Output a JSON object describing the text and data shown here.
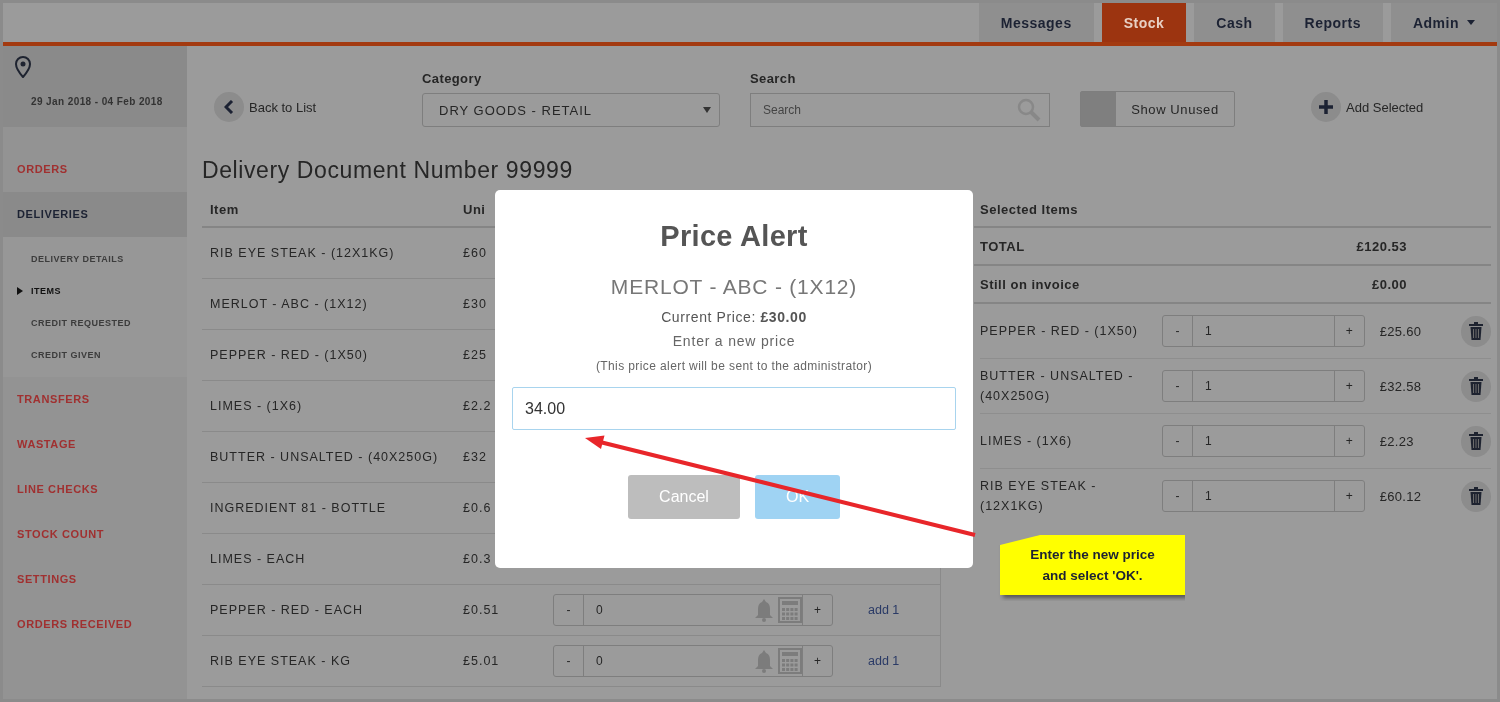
{
  "nav_tabs": [
    {
      "label": "Messages",
      "selected": false,
      "has_menu": false
    },
    {
      "label": "Stock",
      "selected": true,
      "has_menu": false
    },
    {
      "label": "Cash",
      "selected": false,
      "has_menu": false
    },
    {
      "label": "Reports",
      "selected": false,
      "has_menu": false
    },
    {
      "label": "Admin",
      "selected": false,
      "has_menu": true
    }
  ],
  "sidebar": {
    "date_range": "29 Jan 2018 - 04 Feb 2018",
    "items": [
      {
        "label": "ORDERS",
        "selected": false
      },
      {
        "label": "DELIVERIES",
        "selected": true,
        "children": [
          {
            "label": "DELIVERY DETAILS",
            "selected": false
          },
          {
            "label": "ITEMS",
            "selected": true
          },
          {
            "label": "CREDIT REQUESTED",
            "selected": false
          },
          {
            "label": "CREDIT GIVEN",
            "selected": false
          }
        ]
      },
      {
        "label": "TRANSFERS",
        "selected": false
      },
      {
        "label": "WASTAGE",
        "selected": false
      },
      {
        "label": "LINE CHECKS",
        "selected": false
      },
      {
        "label": "STOCK COUNT",
        "selected": false
      },
      {
        "label": "SETTINGS",
        "selected": false
      },
      {
        "label": "ORDERS RECEIVED",
        "selected": false
      }
    ]
  },
  "toolbar": {
    "back_link": "Back to List",
    "category": {
      "label": "Category",
      "value": "DRY GOODS - RETAIL"
    },
    "search": {
      "label": "Search",
      "placeholder": "Search"
    },
    "show_unused": "Show Unused",
    "add_selected": "Add Selected"
  },
  "title": "Delivery Document Number 99999",
  "table": {
    "columns": [
      "Item",
      "Uni"
    ],
    "rows": [
      {
        "item": "RIB EYE STEAK - (12X1KG)",
        "unit_price": "£60"
      },
      {
        "item": "MERLOT - ABC - (1X12)",
        "unit_price": "£30"
      },
      {
        "item": "PEPPER - RED - (1X50)",
        "unit_price": "£25"
      },
      {
        "item": "LIMES - (1X6)",
        "unit_price": "£2.2"
      },
      {
        "item": "BUTTER - UNSALTED - (40X250G)",
        "unit_price": "£32"
      },
      {
        "item": "INGREDIENT 81 - BOTTLE",
        "unit_price": "£0.6"
      },
      {
        "item": "LIMES - EACH",
        "unit_price": "£0.3"
      },
      {
        "item": "PEPPER - RED - EACH",
        "unit_price": "£0.51",
        "quantity": "0",
        "minus": "-",
        "plus": "+",
        "add": "add 1"
      },
      {
        "item": "RIB EYE STEAK - KG",
        "unit_price": "£5.01",
        "quantity": "0",
        "minus": "-",
        "plus": "+",
        "add": "add 1"
      }
    ]
  },
  "selected_panel": {
    "heading": "Selected Items",
    "summary": [
      {
        "label": "TOTAL",
        "value": "£120.53"
      },
      {
        "label": "Still on invoice",
        "value": "£0.00"
      }
    ],
    "items": [
      {
        "name": "PEPPER - RED - (1X50)",
        "minus": "-",
        "quantity": "1",
        "plus": "+",
        "price": "£25.60"
      },
      {
        "name": "BUTTER - UNSALTED - (40X250G)",
        "minus": "-",
        "quantity": "1",
        "plus": "+",
        "price": "£32.58"
      },
      {
        "name": "LIMES - (1X6)",
        "minus": "-",
        "quantity": "1",
        "plus": "+",
        "price": "£2.23"
      },
      {
        "name": "RIB EYE STEAK - (12X1KG)",
        "minus": "-",
        "quantity": "1",
        "plus": "+",
        "price": "£60.12"
      }
    ]
  },
  "modal": {
    "title": "Price Alert",
    "item": "MERLOT - ABC - (1X12)",
    "current_price": "Current Price: **£30.00**",
    "prompt": "Enter a new price",
    "note": "(This price alert will be sent to the administrator)",
    "value": "34.00",
    "buttons": [
      {
        "label": "Cancel",
        "kind": "cancel"
      },
      {
        "label": "OK",
        "kind": "ok"
      }
    ]
  },
  "callout": {
    "text": "Enter the new price and select 'OK'."
  }
}
